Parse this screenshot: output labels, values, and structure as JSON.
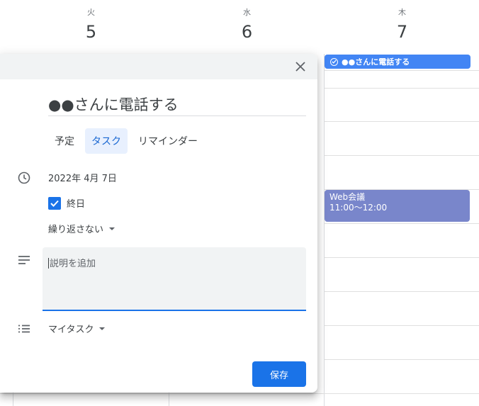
{
  "calendar": {
    "days": [
      {
        "dow": "火",
        "num": "5"
      },
      {
        "dow": "水",
        "num": "6"
      },
      {
        "dow": "木",
        "num": "7"
      }
    ],
    "task_chip": "●●さんに電話する",
    "event": {
      "title": "Web会議",
      "time": "11:00～12:00"
    }
  },
  "dialog": {
    "title_value": "●●さんに電話する",
    "tabs": [
      "予定",
      "タスク",
      "リマインダー"
    ],
    "active_tab": "タスク",
    "date": "2022年 4月 7日",
    "allday_label": "終日",
    "allday_checked": true,
    "repeat": "繰り返さない",
    "description_placeholder": "説明を追加",
    "tasklist": "マイタスク",
    "save_label": "保存"
  },
  "colors": {
    "accent": "#1a73e8",
    "task_chip": "#4285f4",
    "event_chip": "#7986cb"
  },
  "icons": [
    "close-icon",
    "clock-icon",
    "checkbox-checked-icon",
    "notes-icon",
    "list-icon",
    "check-circle-icon",
    "caret-down-icon"
  ]
}
